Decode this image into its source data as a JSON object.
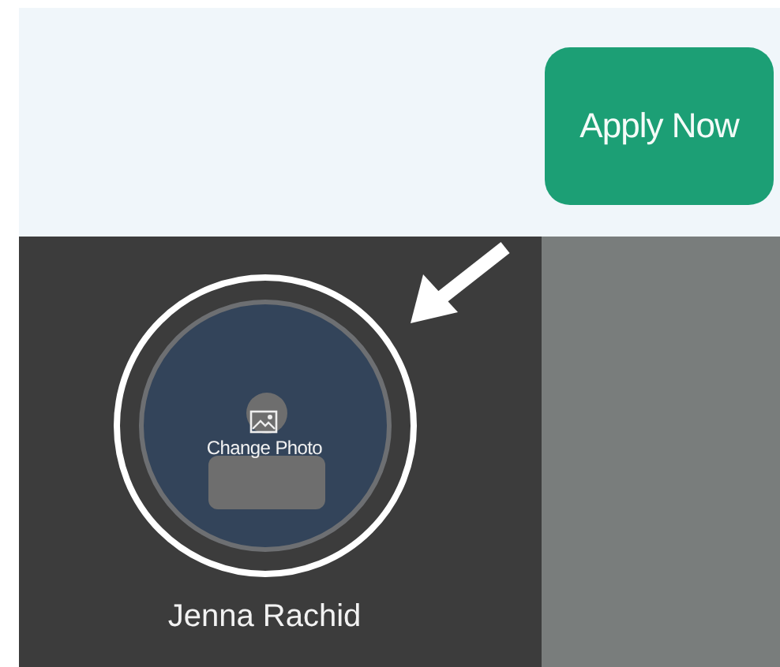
{
  "header": {
    "apply_button": "Apply Now"
  },
  "profile": {
    "change_photo": "Change Photo",
    "name": "Jenna Rachid"
  }
}
